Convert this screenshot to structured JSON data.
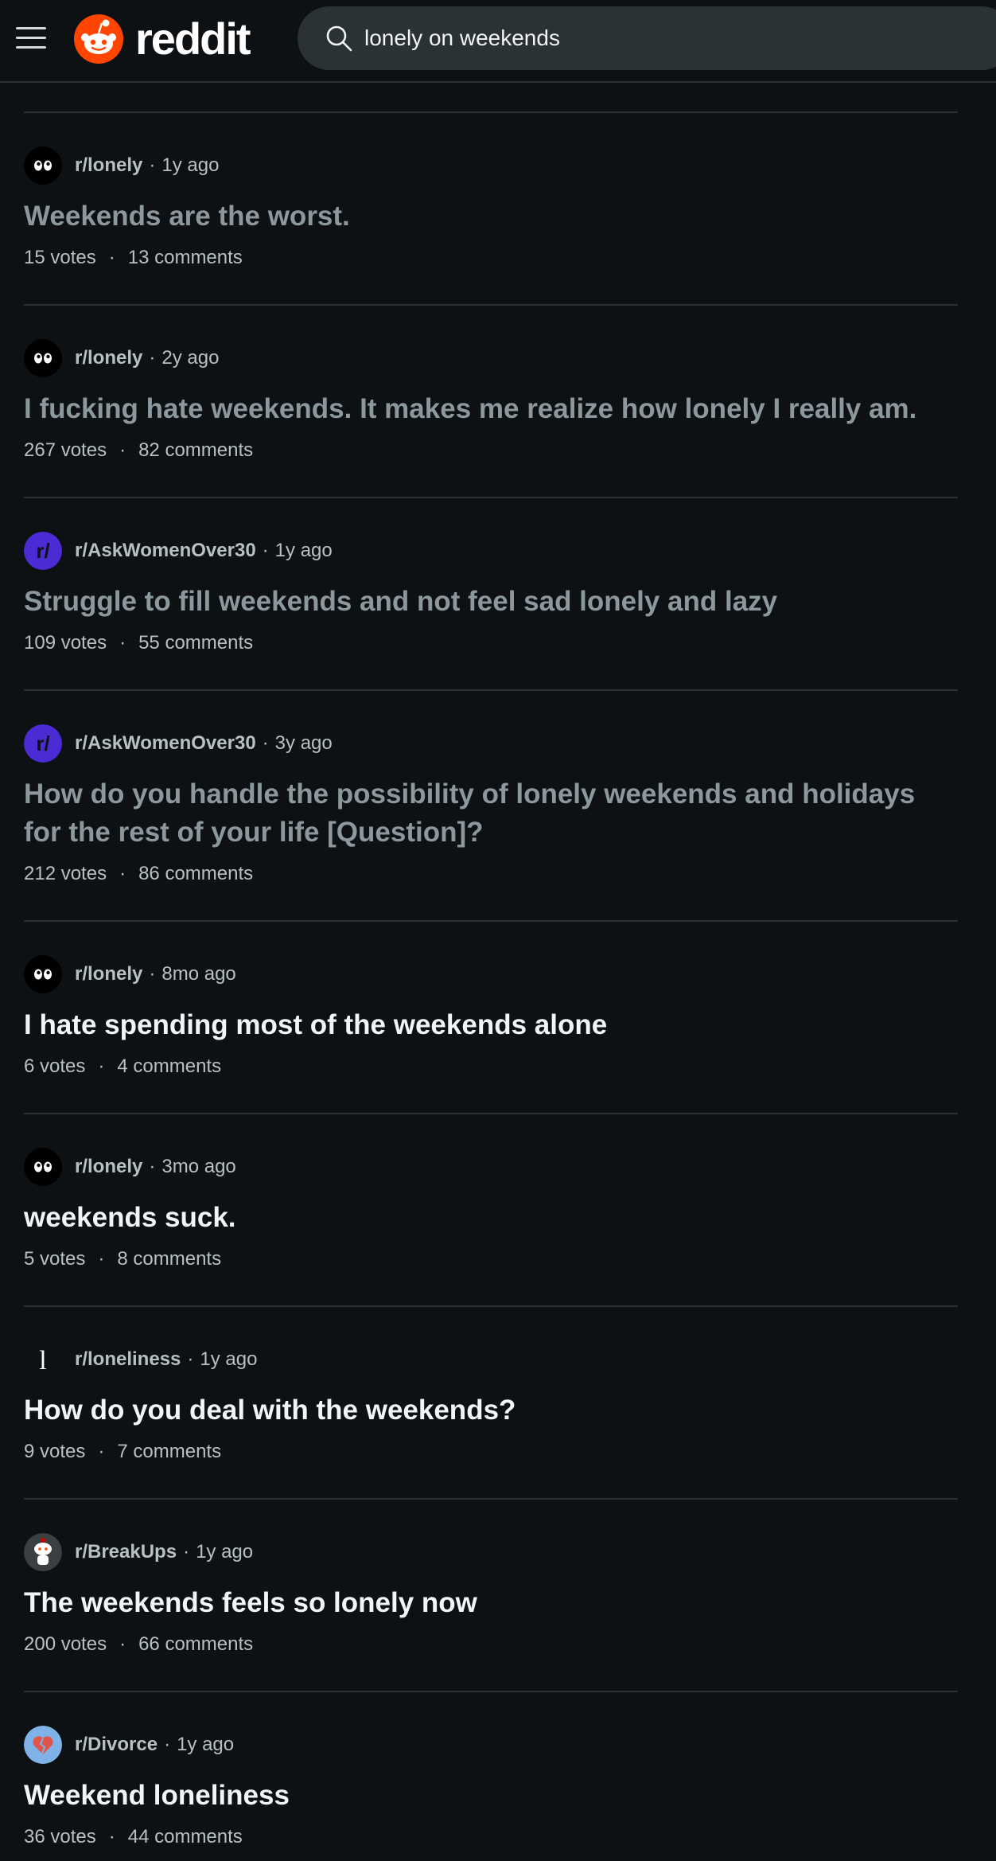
{
  "header": {
    "logo_text": "reddit",
    "search_value": "lonely on weekends"
  },
  "colors": {
    "background": "#0e1113",
    "reddit_orange": "#ff4500",
    "visited_title": "#8c979e",
    "unvisited_title": "#f2f4f5",
    "divider": "#2a3236",
    "askwomen_avatar": "#4a2bd4"
  },
  "posts": [
    {
      "subreddit": "r/lonely",
      "age": "1y ago",
      "title": "Weekends are the worst.",
      "votes": "15 votes",
      "comments": "13 comments",
      "visited": true,
      "avatar_icon": "lonely-eyes-icon"
    },
    {
      "subreddit": "r/lonely",
      "age": "2y ago",
      "title": "I fucking hate weekends. It makes me realize how lonely I really am.",
      "votes": "267 votes",
      "comments": "82 comments",
      "visited": true,
      "avatar_icon": "lonely-eyes-icon"
    },
    {
      "subreddit": "r/AskWomenOver30",
      "age": "1y ago",
      "title": "Struggle to fill weekends and not feel sad lonely and lazy",
      "votes": "109 votes",
      "comments": "55 comments",
      "visited": true,
      "avatar_icon": "subreddit-r-icon"
    },
    {
      "subreddit": "r/AskWomenOver30",
      "age": "3y ago",
      "title": "How do you handle the possibility of lonely weekends and holidays for the rest of your life [Question]?",
      "votes": "212 votes",
      "comments": "86 comments",
      "visited": true,
      "avatar_icon": "subreddit-r-icon"
    },
    {
      "subreddit": "r/lonely",
      "age": "8mo ago",
      "title": "I hate spending most of the weekends alone",
      "votes": "6 votes",
      "comments": "4 comments",
      "visited": false,
      "avatar_icon": "lonely-eyes-icon"
    },
    {
      "subreddit": "r/lonely",
      "age": "3mo ago",
      "title": "weekends suck.",
      "votes": "5 votes",
      "comments": "8 comments",
      "visited": false,
      "avatar_icon": "lonely-eyes-icon"
    },
    {
      "subreddit": "r/loneliness",
      "age": "1y ago",
      "title": "How do you deal with the weekends?",
      "votes": "9 votes",
      "comments": "7 comments",
      "visited": false,
      "avatar_icon": "loneliness-letter-icon"
    },
    {
      "subreddit": "r/BreakUps",
      "age": "1y ago",
      "title": "The weekends feels so lonely now",
      "votes": "200 votes",
      "comments": "66 comments",
      "visited": false,
      "avatar_icon": "snoo-avatar-icon"
    },
    {
      "subreddit": "r/Divorce",
      "age": "1y ago",
      "title": "Weekend loneliness",
      "votes": "36 votes",
      "comments": "44 comments",
      "visited": false,
      "avatar_icon": "broken-heart-icon"
    }
  ],
  "separator": "·"
}
